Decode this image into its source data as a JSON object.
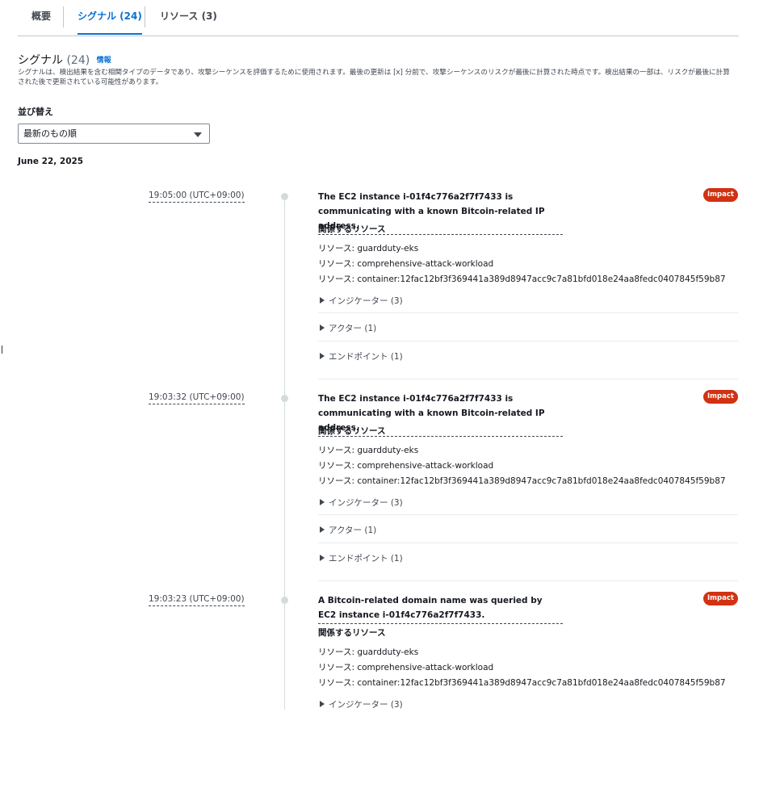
{
  "tabs": [
    {
      "label": "概要"
    },
    {
      "label": "シグナル (24)"
    },
    {
      "label": "リソース (3)"
    }
  ],
  "header": {
    "title": "シグナル",
    "count": "(24)",
    "info": "情報",
    "description": "シグナルは、検出結果を含む相関タイプのデータであり、攻撃シーケンスを評価するために使用されます。最後の更新は [x] 分前で、攻撃シーケンスのリスクが最後に計算された時点です。検出結果の一部は、リスクが最後に計算された後で更新されている可能性があります。"
  },
  "sort": {
    "label": "並び替え",
    "selected": "最新のもの順"
  },
  "date": "June 22, 2025",
  "related_label": "関係するリソース",
  "entries": [
    {
      "time": "19:05:00 (UTC+09:00)",
      "title": "The EC2 instance i-01f4c776a2f7f7433 is communicating with a known Bitcoin-related IP address.",
      "badge": "Impact",
      "resources": [
        "リソース: guardduty-eks",
        "リソース: comprehensive-attack-workload",
        "リソース: container:12fac12bf3f369441a389d8947acc9c7a81bfd018e24aa8fedc0407845f59b87"
      ],
      "expanders": [
        "インジケーター (3)",
        "アクター (1)",
        "エンドポイント (1)"
      ]
    },
    {
      "time": "19:03:32 (UTC+09:00)",
      "title": "The EC2 instance i-01f4c776a2f7f7433 is communicating with a known Bitcoin-related IP address.",
      "badge": "Impact",
      "resources": [
        "リソース: guardduty-eks",
        "リソース: comprehensive-attack-workload",
        "リソース: container:12fac12bf3f369441a389d8947acc9c7a81bfd018e24aa8fedc0407845f59b87"
      ],
      "expanders": [
        "インジケーター (3)",
        "アクター (1)",
        "エンドポイント (1)"
      ]
    },
    {
      "time": "19:03:23 (UTC+09:00)",
      "title": "A Bitcoin-related domain name was queried by EC2 instance i-01f4c776a2f7f7433.",
      "badge": "Impact",
      "resources": [
        "リソース: guardduty-eks",
        "リソース: comprehensive-attack-workload",
        "リソース: container:12fac12bf3f369441a389d8947acc9c7a81bfd018e24aa8fedc0407845f59b87"
      ],
      "expanders": [
        "インジケーター (3)"
      ]
    }
  ]
}
